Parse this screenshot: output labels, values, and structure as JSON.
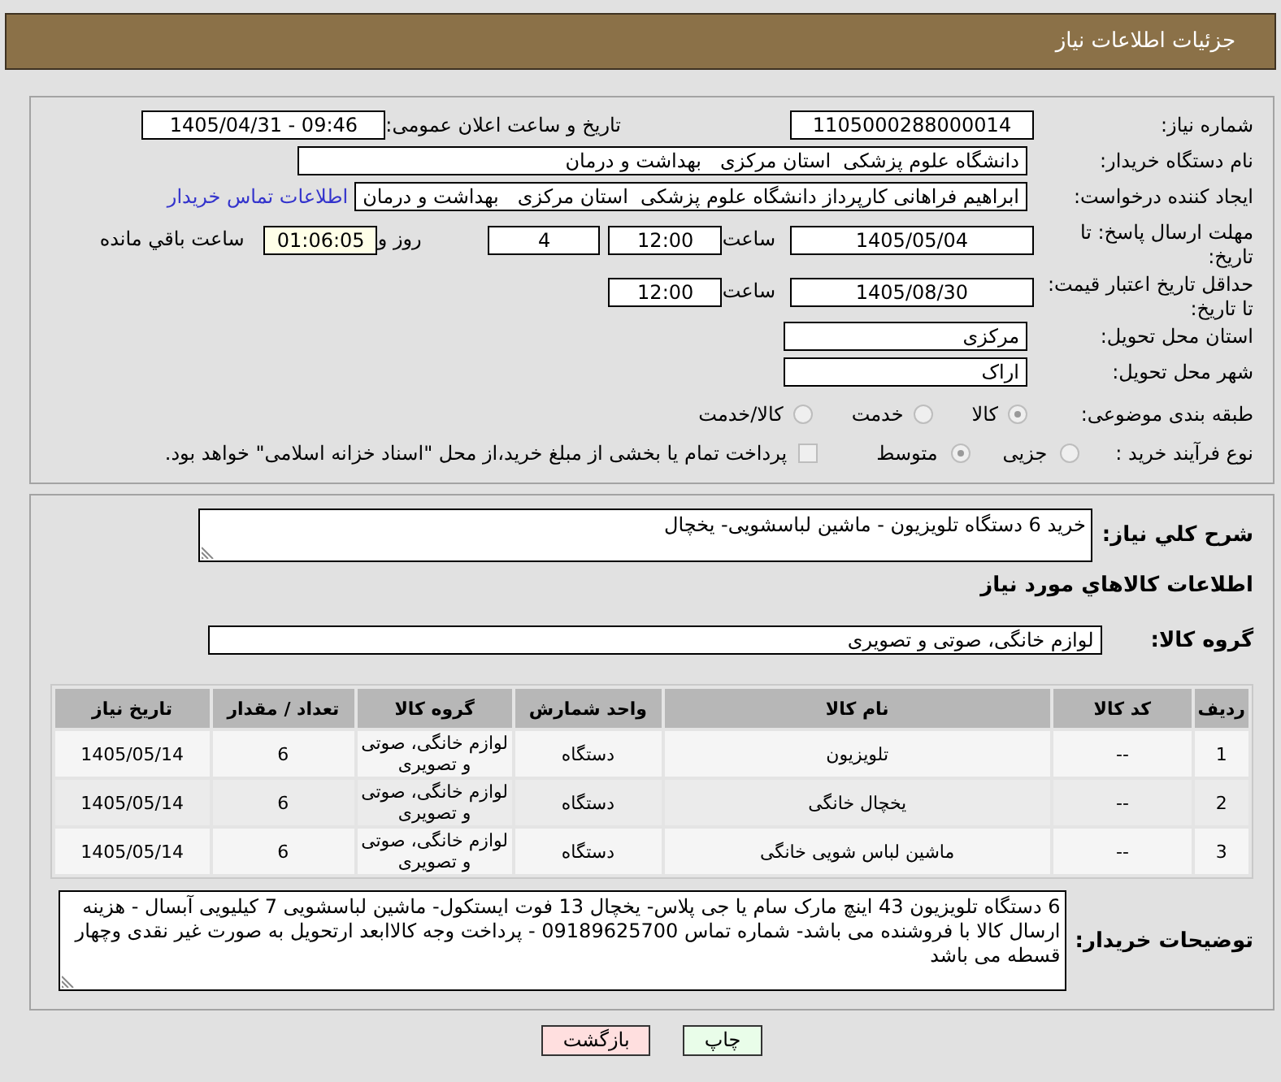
{
  "window": {
    "title": "جزئیات اطلاعات نیاز"
  },
  "need_info": {
    "need_number": {
      "label": "شماره نیاز:",
      "value": "1105000288000014"
    },
    "announce_datetime": {
      "label": "تاریخ و ساعت اعلان عمومی:",
      "value": "1405/04/31 - 09:46"
    },
    "buyer_org": {
      "label": "نام دستگاه خریدار:",
      "value": "دانشگاه علوم پزشکی  استان مرکزی   بهداشت و درمان"
    },
    "requester": {
      "label": "ایجاد کننده درخواست:",
      "value": "ابراهیم فراهانی کارپرداز دانشگاه علوم پزشکی  استان مرکزی   بهداشت و درمان",
      "link": "اطلاعات تماس خریدار"
    },
    "reply_deadline": {
      "label": "مهلت ارسال پاسخ: تا تاریخ:",
      "date": "1405/05/04",
      "time_label": "ساعت",
      "time": "12:00",
      "days": "4",
      "days_label": "روز و",
      "remaining": "01:06:05",
      "remaining_label": "ساعت باقي مانده"
    },
    "price_validity": {
      "label": "حداقل تاریخ اعتبار قیمت: تا تاریخ:",
      "date": "1405/08/30",
      "time_label": "ساعت",
      "time": "12:00"
    },
    "delivery_province": {
      "label": "استان محل تحویل:",
      "value": "مرکزی"
    },
    "delivery_city": {
      "label": "شهر محل تحویل:",
      "value": "اراک"
    },
    "category": {
      "label": "طبقه بندی موضوعی:",
      "options": [
        {
          "label": "کالا",
          "selected": true,
          "disabled": true
        },
        {
          "label": "خدمت",
          "selected": false,
          "disabled": true
        },
        {
          "label": "کالا/خدمت",
          "selected": false,
          "disabled": true
        }
      ]
    },
    "purchase_process": {
      "label": "نوع فرآیند خرید :",
      "options": [
        {
          "label": "جزیی",
          "selected": false,
          "disabled": true
        },
        {
          "label": "متوسط",
          "selected": true,
          "disabled": true
        }
      ],
      "treasury_payment": {
        "label": "پرداخت تمام یا بخشی از مبلغ خرید،از محل \"اسناد خزانه اسلامی\" خواهد بود.",
        "checked": false,
        "disabled": true
      }
    }
  },
  "need_summary": {
    "description": {
      "label": "شرح کلي نیاز:",
      "value": "خرید 6 دستگاه تلویزیون - ماشین لباسشویی- یخچال"
    },
    "goods_heading": "اطلاعات کالاهاي مورد نیاز",
    "goods_group": {
      "label": "گروه کالا:",
      "value": "لوازم خانگی، صوتی و تصویری"
    },
    "items_table": {
      "columns": [
        "ردیف",
        "کد کالا",
        "نام کالا",
        "واحد شمارش",
        "گروه کالا",
        "تعداد / مقدار",
        "تاریخ نیاز"
      ],
      "rows": [
        [
          "1",
          "--",
          "تلویزیون",
          "دستگاه",
          "لوازم خانگی، صوتی و تصویری",
          "6",
          "1405/05/14"
        ],
        [
          "2",
          "--",
          "یخچال خانگی",
          "دستگاه",
          "لوازم خانگی، صوتی و تصویری",
          "6",
          "1405/05/14"
        ],
        [
          "3",
          "--",
          "ماشین لباس شویی خانگی",
          "دستگاه",
          "لوازم خانگی، صوتی و تصویری",
          "6",
          "1405/05/14"
        ]
      ]
    },
    "buyer_notes": {
      "label": "توضیحات خریدار:",
      "value": "6 دستگاه تلویزیون 43 اینچ مارک سام یا جی پلاس- یخچال 13 فوت ایستکول- ماشین لباسشویی 7 کیلیویی آبسال - هزینه ارسال کالا با فروشنده می باشد- شماره تماس 09189625700 - پرداخت وجه کالاابعد ارتحویل به صورت غیر نقدی وچهار قسطه می باشد"
    }
  },
  "buttons": [
    {
      "label": "چاپ",
      "kind": "print"
    },
    {
      "label": "بازگشت",
      "kind": "back"
    }
  ]
}
